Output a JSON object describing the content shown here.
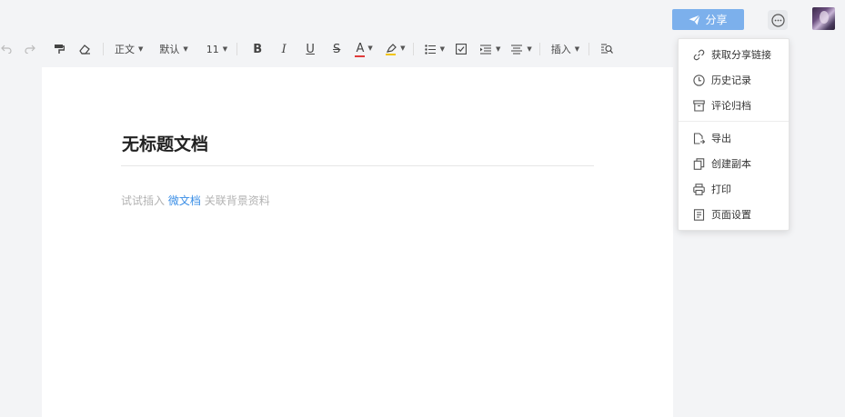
{
  "header": {
    "share_label": "分享",
    "more_icon": "more-icon",
    "avatar": "user-avatar"
  },
  "toolbar": {
    "undo_icon": "undo-icon",
    "redo_icon": "redo-icon",
    "format_painter_icon": "format-painter-icon",
    "clear_format_icon": "eraser-icon",
    "paragraph_style": "正文",
    "font_family": "默认",
    "font_size": "11",
    "bold": "B",
    "italic": "I",
    "underline": "U",
    "strike": "S",
    "font_color": "A",
    "insert_label": "插入",
    "colors": {
      "font_color_bar": "#e03b3b",
      "highlight_bar": "#f1c40f"
    }
  },
  "document": {
    "title": "无标题文档",
    "hint_before": "试试插入",
    "hint_link": "微文档",
    "hint_after": "关联背景资料"
  },
  "more_menu": {
    "items": [
      {
        "label": "获取分享链接",
        "icon": "link-icon"
      },
      {
        "label": "历史记录",
        "icon": "clock-icon"
      },
      {
        "label": "评论归档",
        "icon": "archive-icon"
      },
      {
        "label": "导出",
        "icon": "export-icon"
      },
      {
        "label": "创建副本",
        "icon": "copy-icon"
      },
      {
        "label": "打印",
        "icon": "printer-icon"
      },
      {
        "label": "页面设置",
        "icon": "page-settings-icon"
      }
    ]
  },
  "colors": {
    "accent": "#7cb0ec",
    "link": "#3a8ee6",
    "page_bg": "#f3f4f6"
  }
}
